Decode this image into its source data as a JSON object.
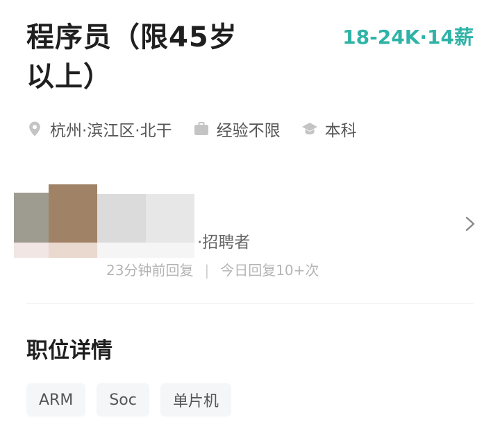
{
  "job": {
    "title": "程序员（限45岁以上）",
    "salary": "18-24K·14薪"
  },
  "meta": {
    "location": "杭州·滨江区·北干",
    "location_icon": "location-pin-icon",
    "experience": "经验不限",
    "experience_icon": "briefcase-icon",
    "education": "本科",
    "education_icon": "graduation-cap-icon"
  },
  "recruiter": {
    "role_suffix": "·招聘者",
    "reply_time": "23分钟前回复",
    "reply_count": "今日回复10+次",
    "separator": "|"
  },
  "details": {
    "section_title": "职位详情",
    "tags": [
      "ARM",
      "Soc",
      "单片机"
    ]
  },
  "colors": {
    "salary": "#2fb3a7",
    "icon": "#c4c4c4",
    "tag_bg": "#f5f6f8"
  }
}
